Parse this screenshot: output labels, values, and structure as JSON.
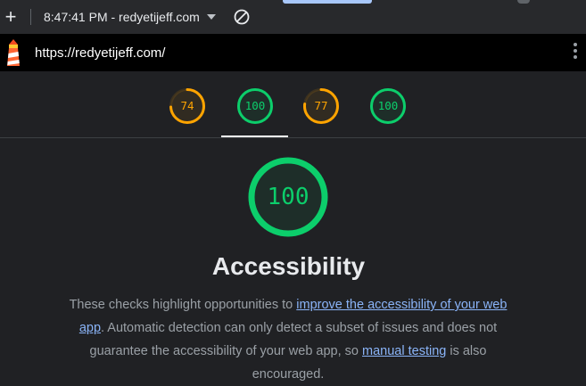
{
  "toolbar": {
    "report_title": "8:47:41 PM - redyetijeff.com",
    "new_icon": "plus-icon",
    "dropdown_icon": "caret-down-icon",
    "clear_icon": "clear-circle-icon"
  },
  "urlbar": {
    "url": "https://redyetijeff.com/",
    "logo_icon": "lighthouse-icon",
    "menu_icon": "kebab-menu-icon"
  },
  "score_tabs": [
    {
      "score": 74,
      "display": "74",
      "color": "#ffa400"
    },
    {
      "score": 100,
      "display": "100",
      "color": "#0cce6b"
    },
    {
      "score": 77,
      "display": "77",
      "color": "#ffa400"
    },
    {
      "score": 100,
      "display": "100",
      "color": "#0cce6b"
    }
  ],
  "category": {
    "score": 100,
    "display": "100",
    "color": "#0cce6b",
    "title": "Accessibility",
    "desc_part1": "These checks highlight opportunities to ",
    "link1": "improve the accessibility of your web app",
    "desc_part2": ". Automatic detection can only detect a subset of issues and does not guarantee the accessibility of your web app, so ",
    "link2": "manual testing",
    "desc_part3": " is also encouraged."
  },
  "colors": {
    "pass": "#0cce6b",
    "average": "#ffa400",
    "link": "#8ab4f8",
    "background": "#202124"
  }
}
